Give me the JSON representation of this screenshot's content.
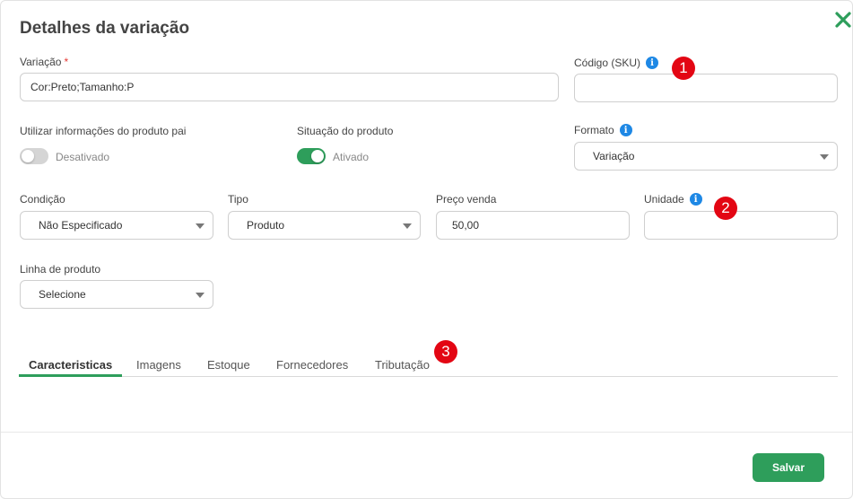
{
  "modal": {
    "title": "Detalhes da variação",
    "close_icon": "close-x-icon",
    "accent_color": "#2e9e5b"
  },
  "fields": {
    "variacao": {
      "label": "Variação",
      "required_mark": "*",
      "value": "Cor:Preto;Tamanho:P"
    },
    "sku": {
      "label": "Código (SKU)",
      "info": "i",
      "value": ""
    },
    "usar_pai": {
      "label": "Utilizar informações do produto pai",
      "state": "Desativado",
      "checked": false
    },
    "situacao": {
      "label": "Situação do produto",
      "state": "Ativado",
      "checked": true
    },
    "formato": {
      "label": "Formato",
      "info": "i",
      "value": "Variação"
    },
    "condicao": {
      "label": "Condição",
      "value": "Não Especificado"
    },
    "tipo": {
      "label": "Tipo",
      "value": "Produto"
    },
    "preco": {
      "label": "Preço venda",
      "value": "50,00"
    },
    "unidade": {
      "label": "Unidade",
      "info": "i",
      "value": ""
    },
    "linha": {
      "label": "Linha de produto",
      "value": "Selecione"
    }
  },
  "tabs": [
    {
      "label": "Caracteristicas",
      "active": true
    },
    {
      "label": "Imagens",
      "active": false
    },
    {
      "label": "Estoque",
      "active": false
    },
    {
      "label": "Fornecedores",
      "active": false
    },
    {
      "label": "Tributação",
      "active": false
    }
  ],
  "badges": [
    "1",
    "2",
    "3"
  ],
  "footer": {
    "save_label": "Salvar"
  }
}
